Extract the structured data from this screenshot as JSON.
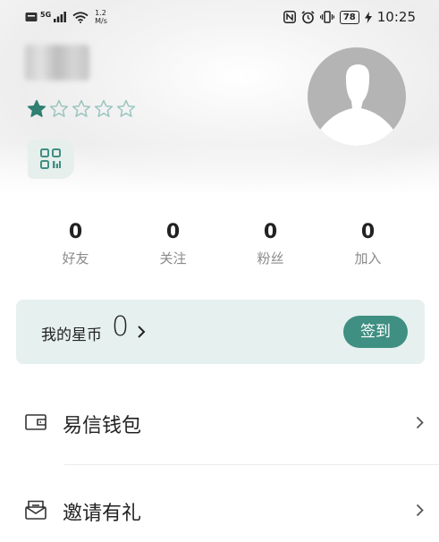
{
  "status_bar": {
    "network_type": "5G",
    "speed_value": "1.2",
    "speed_unit": "M/s",
    "battery": "78",
    "time": "10:25"
  },
  "profile": {
    "rating_filled": 1,
    "rating_max": 5
  },
  "stats": [
    {
      "count": "0",
      "label": "好友"
    },
    {
      "count": "0",
      "label": "关注"
    },
    {
      "count": "0",
      "label": "粉丝"
    },
    {
      "count": "0",
      "label": "加入"
    }
  ],
  "coins": {
    "label": "我的星币",
    "count": "0",
    "checkin_label": "签到"
  },
  "menu": [
    {
      "label": "易信钱包",
      "icon": "wallet-icon"
    },
    {
      "label": "邀请有礼",
      "icon": "gift-envelope-icon"
    }
  ],
  "colors": {
    "accent": "#3f8f82",
    "card_bg": "#e6f0ee",
    "star_filled": "#2f7f73",
    "star_empty": "#9bc5bf"
  }
}
